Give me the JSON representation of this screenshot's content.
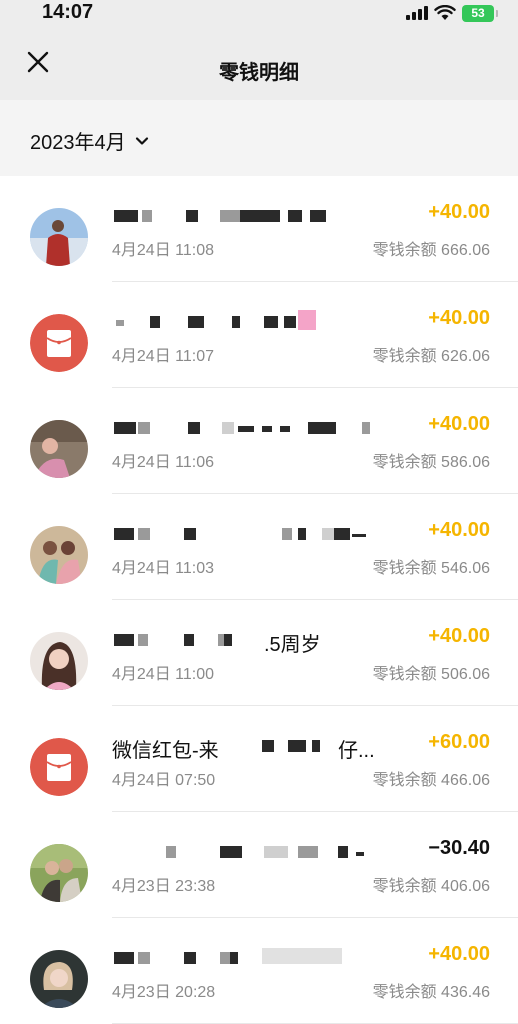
{
  "status_bar": {
    "time": "14:07",
    "battery": "53"
  },
  "nav": {
    "title": "零钱明细"
  },
  "filter": {
    "month": "2023年4月"
  },
  "transactions": [
    {
      "title": "",
      "date": "4月24日 11:08",
      "amount": "+40.00",
      "balance": "零钱余额 666.06"
    },
    {
      "title": "",
      "date": "4月24日 11:07",
      "amount": "+40.00",
      "balance": "零钱余额 626.06"
    },
    {
      "title": "",
      "date": "4月24日 11:06",
      "amount": "+40.00",
      "balance": "零钱余额 586.06"
    },
    {
      "title": "",
      "date": "4月24日 11:03",
      "amount": "+40.00",
      "balance": "零钱余额 546.06"
    },
    {
      "title": ".5周岁",
      "date": "4月24日 11:00",
      "amount": "+40.00",
      "balance": "零钱余额 506.06"
    },
    {
      "title": "微信红包-来",
      "title_suffix": "仔...",
      "date": "4月24日 07:50",
      "amount": "+60.00",
      "balance": "零钱余额 466.06"
    },
    {
      "title": "",
      "date": "4月23日 23:38",
      "amount": "−30.40",
      "balance": "零钱余额 406.06"
    },
    {
      "title": "",
      "date": "4月23日 20:28",
      "amount": "+40.00",
      "balance": "零钱余额 436.46"
    }
  ],
  "colors": {
    "income": "#f5b500",
    "expense": "#111111",
    "red_packet": "#e0584a",
    "header_bg": "#ededed"
  }
}
